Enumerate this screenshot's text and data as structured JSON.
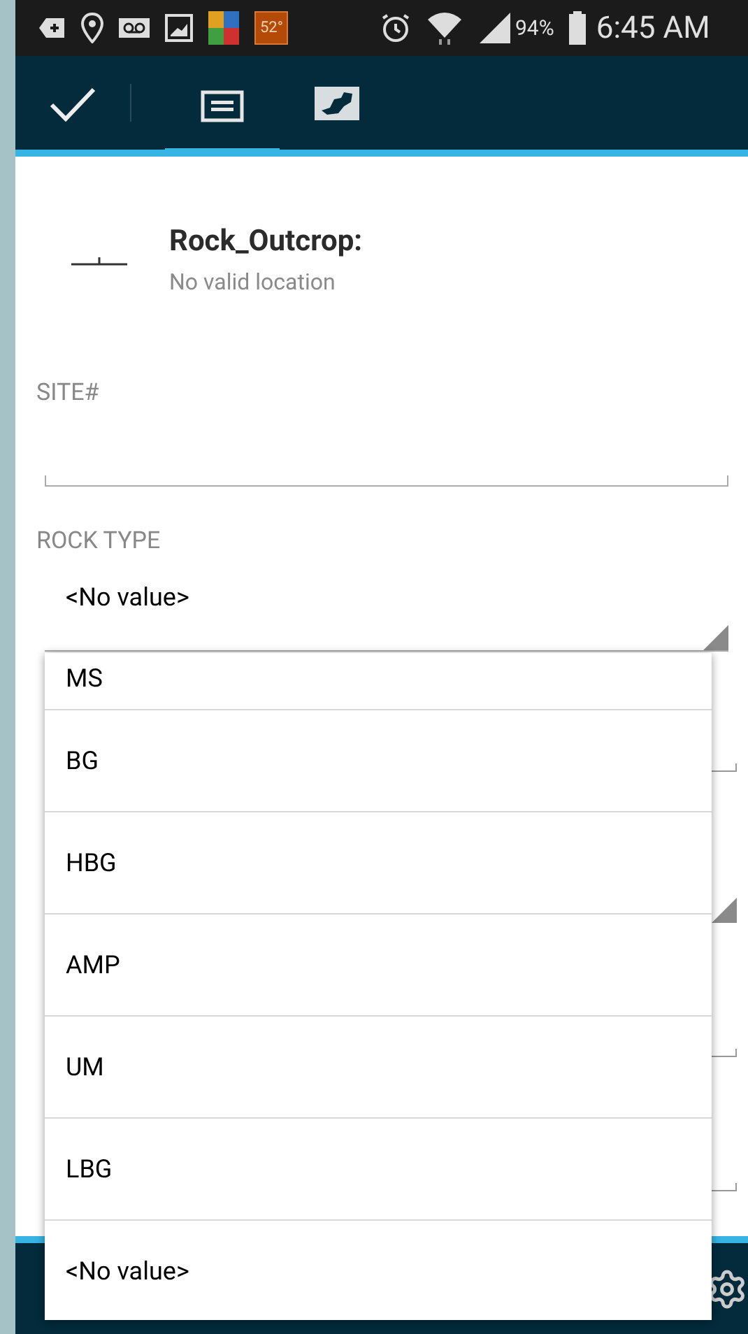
{
  "status_bar": {
    "temperature": "52°",
    "battery": "94%",
    "time": "6:45 AM"
  },
  "toolbar": {
    "tabs": [
      {
        "kind": "form",
        "selected": true
      },
      {
        "kind": "map",
        "selected": false
      }
    ]
  },
  "feature": {
    "title": "Rock_Outcrop:",
    "subtitle": "No valid location"
  },
  "fields": [
    {
      "kind": "text",
      "label": "SITE#"
    },
    {
      "kind": "choice",
      "label": "ROCK TYPE",
      "value": "<No value>"
    }
  ],
  "hidden_fields": [
    {
      "kind": "text"
    },
    {
      "kind": "choice"
    },
    {
      "kind": "text"
    },
    {
      "kind": "text"
    }
  ],
  "dropdown": {
    "options": [
      {
        "label": "MS",
        "selected": false
      },
      {
        "label": "BG",
        "selected": false
      },
      {
        "label": "HBG",
        "selected": false
      },
      {
        "label": "AMP",
        "selected": false
      },
      {
        "label": "UM",
        "selected": false
      },
      {
        "label": "LBG",
        "selected": false
      },
      {
        "label": "<No value>",
        "selected": false
      }
    ]
  }
}
